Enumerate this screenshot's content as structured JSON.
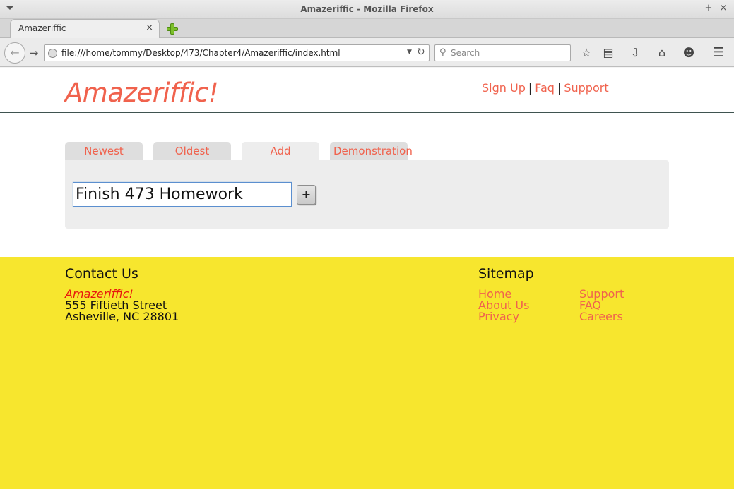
{
  "window": {
    "title": "Amazeriffic - Mozilla Firefox",
    "controls": {
      "minimize": "–",
      "maximize": "+",
      "close": "×"
    }
  },
  "browser": {
    "tab_title": "Amazeriffic",
    "url": "file:///home/tommy/Desktop/473/Chapter4/Amazeriffic/index.html",
    "search_placeholder": "Search",
    "icons": [
      "back-icon",
      "forward-icon",
      "reload-icon",
      "bookmark-star-icon",
      "reading-list-icon",
      "download-icon",
      "home-icon",
      "chat-icon",
      "hamburger-menu-icon"
    ]
  },
  "header": {
    "brand": "Amazeriffic!",
    "links": [
      "Sign Up",
      "Faq",
      "Support"
    ],
    "separator": "|"
  },
  "tabs": [
    {
      "label": "Newest",
      "active": false
    },
    {
      "label": "Oldest",
      "active": false
    },
    {
      "label": "Add",
      "active": true
    },
    {
      "label": "Demonstration",
      "active": false
    }
  ],
  "add_panel": {
    "input_value": "Finish 473 Homework",
    "button_label": "+"
  },
  "footer": {
    "contact": {
      "heading": "Contact Us",
      "brand": "Amazeriffic!",
      "street": "555 Fiftieth Street",
      "city": "Asheville, NC 28801"
    },
    "sitemap": {
      "heading": "Sitemap",
      "col1": [
        "Home",
        "About Us",
        "Privacy"
      ],
      "col2": [
        "Support",
        "FAQ",
        "Careers"
      ]
    }
  },
  "colors": {
    "accent": "#f0624d",
    "footer_bg": "#f7e62e",
    "contact_brand": "#e8170d"
  }
}
